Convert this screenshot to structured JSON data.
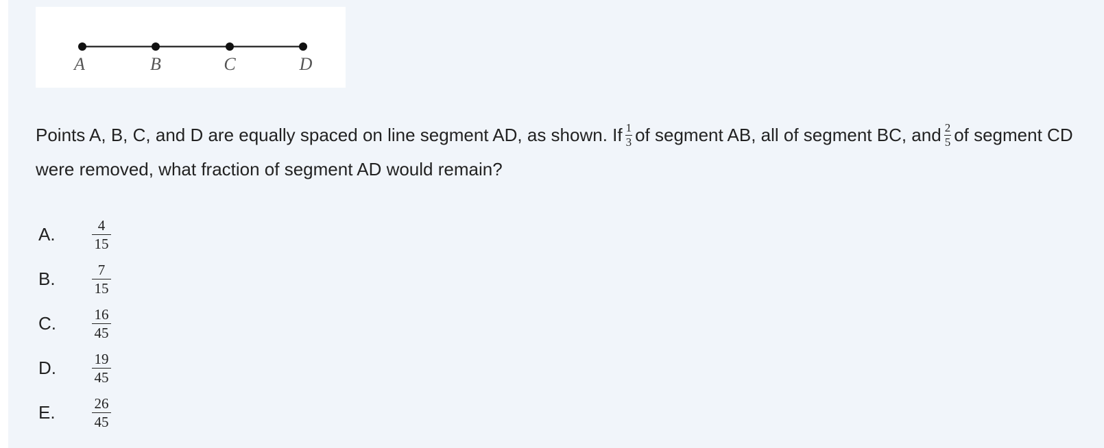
{
  "figure": {
    "points": [
      "A",
      "B",
      "C",
      "D"
    ]
  },
  "question": {
    "part1": "Points A, B, C, and D are equally spaced on line segment AD, as shown. If",
    "frac1": {
      "num": "1",
      "den": "3"
    },
    "part2": "of segment AB, all of segment BC, and",
    "frac2": {
      "num": "2",
      "den": "5"
    },
    "part3": "of segment CD were removed, what fraction of segment AD would remain?"
  },
  "choices": [
    {
      "letter": "A.",
      "num": "4",
      "den": "15"
    },
    {
      "letter": "B.",
      "num": "7",
      "den": "15"
    },
    {
      "letter": "C.",
      "num": "16",
      "den": "45"
    },
    {
      "letter": "D.",
      "num": "19",
      "den": "45"
    },
    {
      "letter": "E.",
      "num": "26",
      "den": "45"
    }
  ],
  "colors": {
    "panel_background": "#f1f5fa",
    "text": "#222222"
  }
}
